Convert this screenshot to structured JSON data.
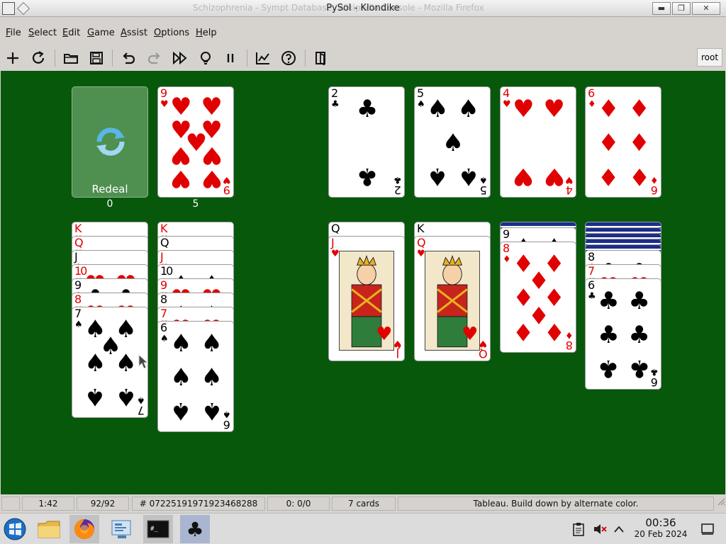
{
  "window": {
    "title": "PySol - Klondike",
    "ghost_title": "Schizophrenia - Sympt Database, Wikipedia Console - Mozilla Firefox",
    "minimize_label": "▬",
    "maximize_label": "❐",
    "close_label": "✕"
  },
  "menu": [
    {
      "label": "File",
      "key": "F",
      "rest": "ile"
    },
    {
      "label": "Select",
      "key": "S",
      "rest": "elect"
    },
    {
      "label": "Edit",
      "key": "E",
      "rest": "dit"
    },
    {
      "label": "Game",
      "key": "G",
      "rest": "ame"
    },
    {
      "label": "Assist",
      "key": "A",
      "rest": "ssist"
    },
    {
      "label": "Options",
      "key": "O",
      "rest": "ptions"
    },
    {
      "label": "Help",
      "key": "H",
      "rest": "elp"
    }
  ],
  "toolbar": {
    "icons": [
      "new-game-icon",
      "restart-icon",
      "open-icon",
      "save-icon",
      "undo-icon",
      "redo-icon",
      "autodrop-icon",
      "hint-icon",
      "pause-icon",
      "statistics-icon",
      "rules-icon",
      "quit-icon"
    ],
    "player": "root"
  },
  "game": {
    "stock": {
      "redeal_label": "Redeal",
      "count": "0"
    },
    "waste": {
      "count": "5",
      "top": {
        "rank": "9",
        "suit": "♥"
      }
    },
    "foundations": [
      {
        "rank": "2",
        "suit": "♣"
      },
      {
        "rank": "5",
        "suit": "♠"
      },
      {
        "rank": "4",
        "suit": "♥"
      },
      {
        "rank": "6",
        "suit": "♦"
      }
    ],
    "tableau": [
      {
        "cards": [
          {
            "rank": "K",
            "suit": "♥"
          },
          {
            "rank": "Q",
            "suit": "♥"
          },
          {
            "rank": "J",
            "suit": "♣"
          },
          {
            "rank": "10",
            "suit": "♥"
          },
          {
            "rank": "9",
            "suit": "♣"
          },
          {
            "rank": "8",
            "suit": "♥"
          },
          {
            "rank": "7",
            "suit": "♠"
          }
        ]
      },
      {
        "cards": [
          {
            "rank": "K",
            "suit": "♥"
          },
          {
            "rank": "Q",
            "suit": "♠"
          },
          {
            "rank": "J",
            "suit": "♥"
          },
          {
            "rank": "10",
            "suit": "♠"
          },
          {
            "rank": "9",
            "suit": "♥"
          },
          {
            "rank": "8",
            "suit": "♠"
          },
          {
            "rank": "7",
            "suit": "♥"
          },
          {
            "rank": "6",
            "suit": "♠"
          }
        ]
      },
      {
        "cards": [
          {
            "rank": "Q",
            "suit": "♠"
          },
          {
            "rank": "J",
            "suit": "♥"
          }
        ]
      },
      {
        "cards": [
          {
            "rank": "K",
            "suit": "♠"
          },
          {
            "rank": "Q",
            "suit": "♥"
          }
        ]
      },
      {
        "facedown": 1,
        "cards": [
          {
            "rank": "9",
            "suit": "♠"
          },
          {
            "rank": "8",
            "suit": "♦"
          }
        ]
      },
      {
        "facedown": 5,
        "cards": [
          {
            "rank": "8",
            "suit": "♣"
          },
          {
            "rank": "7",
            "suit": "♥"
          },
          {
            "rank": "6",
            "suit": "♣"
          }
        ]
      }
    ]
  },
  "status": {
    "time": "1:42",
    "moves": "92/92",
    "game_number": "# 07225191971923468288",
    "score": "0: 0/0",
    "cards": "7 cards",
    "hint": "Tableau. Build down by alternate color."
  },
  "taskbar": {
    "clock": "00:36",
    "date": "20 Feb 2024",
    "apps": [
      "start-orb-icon",
      "file-manager-icon",
      "firefox-icon",
      "control-panel-icon",
      "terminal-icon",
      "pysol-icon"
    ]
  },
  "colors": {
    "felt": "#07580b",
    "red_suit": "#e00000",
    "black_suit": "#000000"
  }
}
